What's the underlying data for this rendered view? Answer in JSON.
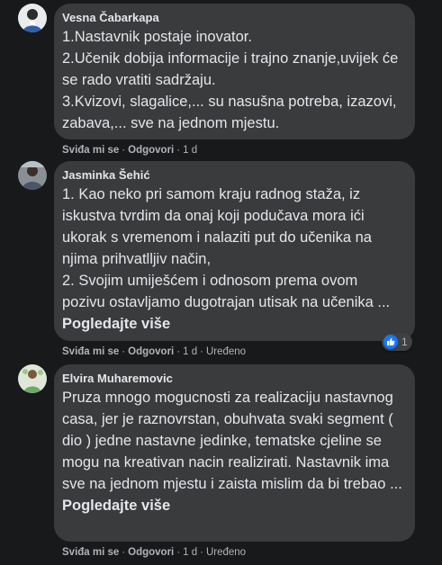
{
  "comments": [
    {
      "author": "Vesna Čabarkapa",
      "text": "1.Nastavnik postaje inovator.\n2.Učenik dobija informacije i trajno znanje,uvijek će se rado vratiti sadržaju.\n3.Kvizovi, slagalice,... su nasušna potreba, izazovi, zabava,... sve na jednom mjestu.",
      "see_more": "",
      "like_label": "Sviđa mi se",
      "reply_label": "Odgovori",
      "time": "1 d",
      "edited": ""
    },
    {
      "author": "Jasminka Šehić",
      "text": "1. Kao neko pri samom kraju radnog staža, iz iskustva tvrdim da onaj koji podučava mora ići ukorak s vremenom i nalaziti put do učenika na njima prihvatlljiv način,\n2. Svojim umiješćem i odnosom prema ovom pozivu ostavljamo dugotrajan utisak na učenika ... ",
      "see_more": "Pogledajte više",
      "like_label": "Sviđa mi se",
      "reply_label": "Odgovori",
      "time": "1 d",
      "edited": "Uređeno",
      "reaction_count": "1"
    },
    {
      "author": "Elvira Muharemovic",
      "text": "Pruza mnogo mogucnosti za realizaciju nastavnog casa, jer je raznovrstan, obuhvata svaki segment ( dio ) jedne nastavne jedinke, tematske cjeline se mogu na kreativan nacin realizirati. Nastavnik ima sve na jednom mjestu i zaista mislim da bi trebao ...\n",
      "see_more": "Pogledajte više",
      "like_label": "Sviđa mi se",
      "reply_label": "Odgovori",
      "time": "1 d",
      "edited": "Uređeno"
    }
  ]
}
